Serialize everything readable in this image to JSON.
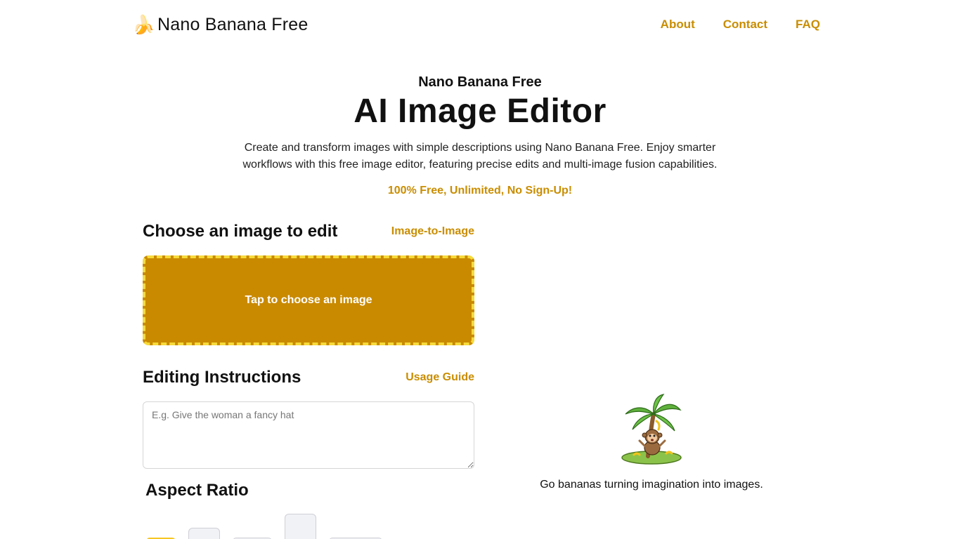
{
  "header": {
    "brand_icon": "banana-icon",
    "brand_emoji": "🍌",
    "brand_name": "Nano Banana Free",
    "nav": [
      "About",
      "Contact",
      "FAQ"
    ]
  },
  "hero": {
    "subtitle": "Nano Banana Free",
    "title": "AI Image Editor",
    "description": "Create and transform images with simple descriptions using Nano Banana Free. Enjoy smarter workflows with this free image editor, featuring precise edits and multi-image fusion capabilities.",
    "free_note": "100% Free, Unlimited, No Sign-Up!"
  },
  "upload": {
    "title": "Choose an image to edit",
    "mode_link": "Image-to-Image",
    "dropzone_label": "Tap to choose an image"
  },
  "instructions": {
    "title": "Editing Instructions",
    "guide_link": "Usage Guide",
    "placeholder": "E.g. Give the woman a fancy hat",
    "value": ""
  },
  "aspect": {
    "title": "Aspect Ratio"
  },
  "preview": {
    "illustration": "monkey-palm-tree-illustration",
    "caption": "Go bananas turning imagination into images."
  },
  "colors": {
    "accent": "#c98d00",
    "dropzone_bg": "#c98a00",
    "dropzone_border": "#f6da3b",
    "ratio_active": "#f6c624"
  }
}
